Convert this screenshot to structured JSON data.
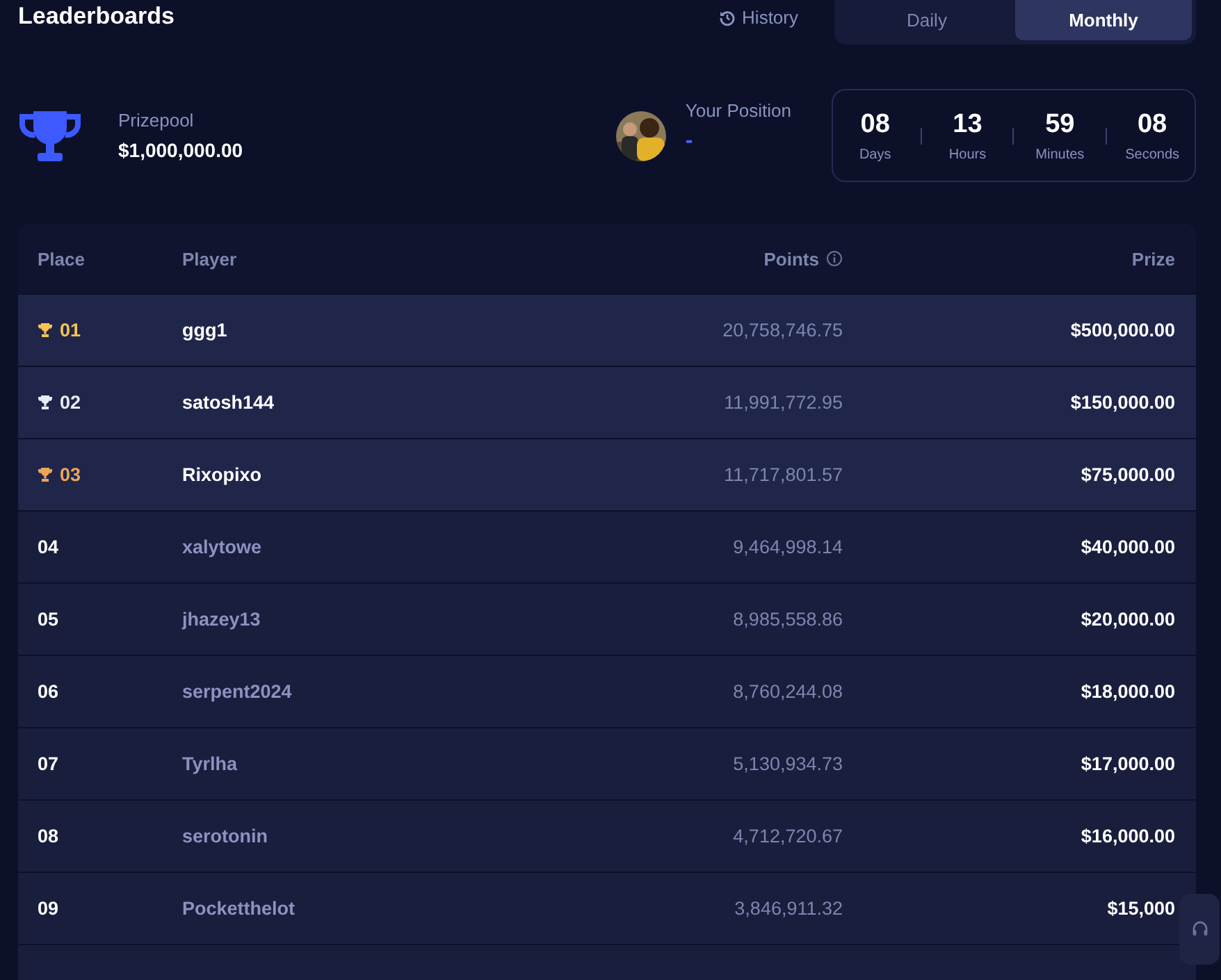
{
  "title": "Leaderboards",
  "history": {
    "label": "History"
  },
  "tabs": [
    {
      "label": "Daily",
      "selected": false
    },
    {
      "label": "Monthly",
      "selected": true
    }
  ],
  "prizepool": {
    "label": "Prizepool",
    "value": "$1,000,000.00"
  },
  "position": {
    "label": "Your Position",
    "value": "-"
  },
  "countdown": [
    {
      "value": "08",
      "unit": "Days"
    },
    {
      "value": "13",
      "unit": "Hours"
    },
    {
      "value": "59",
      "unit": "Minutes"
    },
    {
      "value": "08",
      "unit": "Seconds"
    }
  ],
  "table": {
    "columns": [
      "Place",
      "Player",
      "Points",
      "Prize"
    ],
    "rows": [
      {
        "place": "01",
        "player": "ggg1",
        "points": "20,758,746.75",
        "prize": "$500,000.00",
        "highlighted": true,
        "color": "#f5c453"
      },
      {
        "place": "02",
        "player": "satosh144",
        "points": "11,991,772.95",
        "prize": "$150,000.00",
        "highlighted": true,
        "color": "#e8ecf6"
      },
      {
        "place": "03",
        "player": "Rixopixo",
        "points": "11,717,801.57",
        "prize": "$75,000.00",
        "highlighted": true,
        "color": "#f0a45a"
      },
      {
        "place": "04",
        "player": "xalytowe",
        "points": "9,464,998.14",
        "prize": "$40,000.00",
        "highlighted": false
      },
      {
        "place": "05",
        "player": "jhazey13",
        "points": "8,985,558.86",
        "prize": "$20,000.00",
        "highlighted": false
      },
      {
        "place": "06",
        "player": "serpent2024",
        "points": "8,760,244.08",
        "prize": "$18,000.00",
        "highlighted": false
      },
      {
        "place": "07",
        "player": "Tyrlha",
        "points": "5,130,934.73",
        "prize": "$17,000.00",
        "highlighted": false
      },
      {
        "place": "08",
        "player": "serotonin",
        "points": "4,712,720.67",
        "prize": "$16,000.00",
        "highlighted": false
      },
      {
        "place": "09",
        "player": "Pocketthelot",
        "points": "3,846,911.32",
        "prize": "$15,000",
        "highlighted": false
      }
    ]
  }
}
